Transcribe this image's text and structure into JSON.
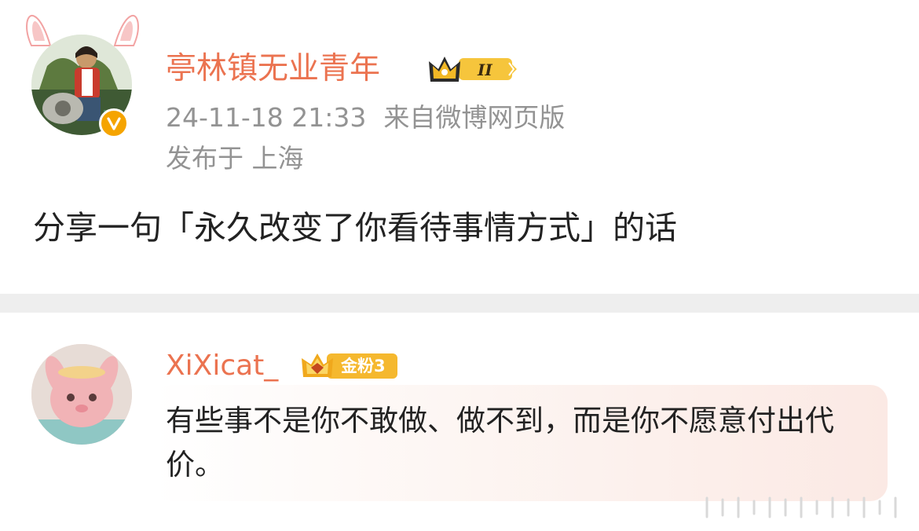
{
  "post": {
    "username": "亭林镇无业青年",
    "level_badge": "II",
    "timestamp": "24-11-18 21:33",
    "source": "来自微博网页版",
    "location": "发布于 上海",
    "text": "分享一句「永久改变了你看待事情方式」的话"
  },
  "comment": {
    "username": "XiXicat_",
    "fan_badge": "金粉3",
    "text": "有些事不是你不敢做、做不到，而是你不愿意付出代价。"
  },
  "colors": {
    "username": "#eb7350",
    "meta": "#939393",
    "text": "#222222",
    "divider": "#eeeeee",
    "verified_badge": "#f5a400"
  },
  "icons": [
    "bunny-ears-icon",
    "verified-icon",
    "crown-level-icon",
    "fan-crown-icon",
    "more-lines-icon"
  ]
}
